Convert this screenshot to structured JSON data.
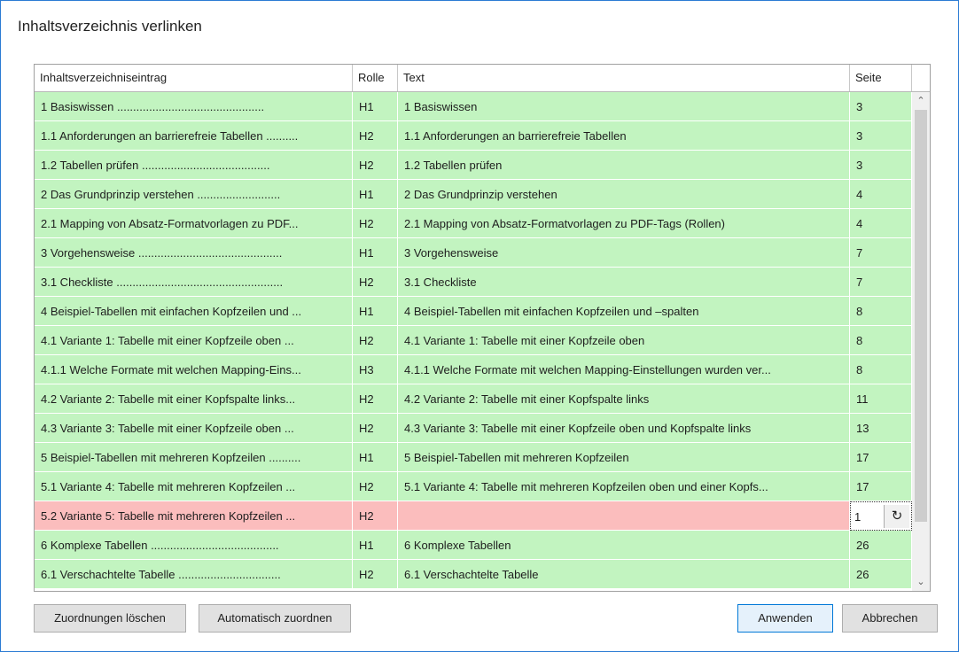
{
  "window": {
    "title": "Inhaltsverzeichnis verlinken"
  },
  "columns": {
    "entry": "Inhaltsverzeichniseintrag",
    "role": "Rolle",
    "text": "Text",
    "page": "Seite"
  },
  "rows": [
    {
      "entry": "1 Basiswissen ..............................................",
      "role": "H1",
      "text": "1 Basiswissen",
      "page": "3"
    },
    {
      "entry": "1.1 Anforderungen an barrierefreie Tabellen ..........",
      "role": "H2",
      "text": "1.1 Anforderungen an barrierefreie Tabellen",
      "page": "3"
    },
    {
      "entry": "1.2 Tabellen prüfen ........................................",
      "role": "H2",
      "text": "1.2 Tabellen prüfen",
      "page": "3"
    },
    {
      "entry": "2 Das Grundprinzip verstehen ..........................",
      "role": "H1",
      "text": "2 Das Grundprinzip verstehen",
      "page": "4"
    },
    {
      "entry": "2.1 Mapping von Absatz-Formatvorlagen zu PDF...",
      "role": "H2",
      "text": "2.1 Mapping von Absatz-Formatvorlagen zu PDF-Tags (Rollen)",
      "page": "4"
    },
    {
      "entry": "3 Vorgehensweise .............................................",
      "role": "H1",
      "text": "3 Vorgehensweise",
      "page": "7"
    },
    {
      "entry": "3.1 Checkliste ....................................................",
      "role": "H2",
      "text": "3.1 Checkliste",
      "page": "7"
    },
    {
      "entry": "4 Beispiel-Tabellen mit einfachen Kopfzeilen und ...",
      "role": "H1",
      "text": "4 Beispiel-Tabellen mit einfachen Kopfzeilen und –spalten",
      "page": "8"
    },
    {
      "entry": "4.1 Variante 1: Tabelle mit einer Kopfzeile oben ...",
      "role": "H2",
      "text": "4.1 Variante 1: Tabelle mit einer Kopfzeile oben",
      "page": "8"
    },
    {
      "entry": "4.1.1 Welche Formate mit welchen Mapping-Eins...",
      "role": "H3",
      "text": "4.1.1 Welche Formate mit welchen Mapping-Einstellungen wurden ver...",
      "page": "8"
    },
    {
      "entry": "4.2 Variante 2: Tabelle mit einer Kopfspalte links...",
      "role": "H2",
      "text": "4.2 Variante 2: Tabelle mit einer Kopfspalte links",
      "page": "11"
    },
    {
      "entry": "4.3 Variante 3: Tabelle mit einer Kopfzeile oben ...",
      "role": "H2",
      "text": "4.3 Variante 3: Tabelle mit einer Kopfzeile oben und Kopfspalte links",
      "page": "13"
    },
    {
      "entry": "5 Beispiel-Tabellen mit mehreren Kopfzeilen ..........",
      "role": "H1",
      "text": "5 Beispiel-Tabellen mit mehreren Kopfzeilen",
      "page": "17"
    },
    {
      "entry": "5.1 Variante 4: Tabelle mit mehreren Kopfzeilen ...",
      "role": "H2",
      "text": "5.1 Variante 4: Tabelle mit mehreren Kopfzeilen oben und einer Kopfs...",
      "page": "17"
    },
    {
      "entry": "5.2 Variante 5: Tabelle mit mehreren Kopfzeilen ...",
      "role": "H2",
      "text": "",
      "page": "1",
      "error": true
    },
    {
      "entry": "6 Komplexe Tabellen ........................................",
      "role": "H1",
      "text": "6 Komplexe Tabellen",
      "page": "26"
    },
    {
      "entry": "6.1 Verschachtelte Tabelle ................................",
      "role": "H2",
      "text": "6.1 Verschachtelte Tabelle",
      "page": "26"
    }
  ],
  "buttons": {
    "clear": "Zuordnungen löschen",
    "auto": "Automatisch zuordnen",
    "apply": "Anwenden",
    "cancel": "Abbrechen"
  },
  "icons": {
    "refresh": "refresh-icon",
    "scroll_up": "chevron-up-icon",
    "scroll_down": "chevron-down-icon"
  }
}
